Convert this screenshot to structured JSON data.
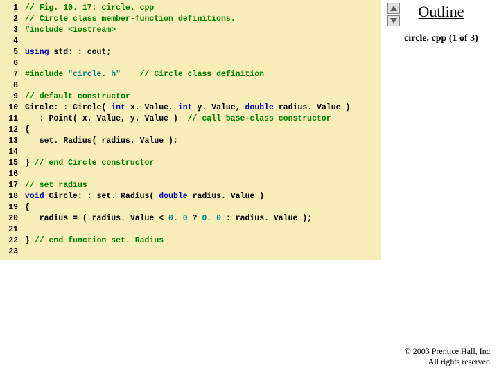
{
  "side": {
    "outline": "Outline",
    "filelabel": "circle. cpp (1 of 3)"
  },
  "footer": {
    "line1": "© 2003 Prentice Hall, Inc.",
    "line2": "All rights reserved."
  },
  "code": {
    "l1_cmt": "// Fig. 10. 17: circle. cpp",
    "l2_cmt": "// Circle class member-function definitions.",
    "l3_inc": "#include",
    "l3_hdr": "<iostream>",
    "l5_kw": "using",
    "l5_rest": " std: : cout;",
    "l7_inc": "#include",
    "l7_str": "\"circle. h\"",
    "l7_cmt": "// Circle class definition",
    "l9_cmt": "// default constructor",
    "l10_a": "Circle: : Circle( ",
    "l10_k1": "int",
    "l10_b": " x. Value, ",
    "l10_k2": "int",
    "l10_c": " y. Value, ",
    "l10_k3": "double",
    "l10_d": " radius. Value )",
    "l11_a": "   : Point( x. Value, y. Value )  ",
    "l11_cmt": "// call base-class constructor",
    "l12": "{",
    "l13": "   set. Radius( radius. Value );",
    "l15_a": "} ",
    "l15_cmt": "// end Circle constructor",
    "l17_cmt": "// set radius",
    "l18_k1": "void",
    "l18_a": " Circle: : set. Radius( ",
    "l18_k2": "double",
    "l18_b": " radius. Value )",
    "l19": "{",
    "l20_a": "   radius = ( radius. Value < ",
    "l20_n1": "0. 0",
    "l20_b": " ? ",
    "l20_n2": "0. 0",
    "l20_c": " : radius. Value );",
    "l22_a": "} ",
    "l22_cmt": "// end function set. Radius"
  },
  "linenos": [
    "1",
    "2",
    "3",
    "4",
    "5",
    "6",
    "7",
    "8",
    "9",
    "10",
    "11",
    "12",
    "13",
    "14",
    "15",
    "16",
    "17",
    "18",
    "19",
    "20",
    "21",
    "22",
    "23"
  ]
}
